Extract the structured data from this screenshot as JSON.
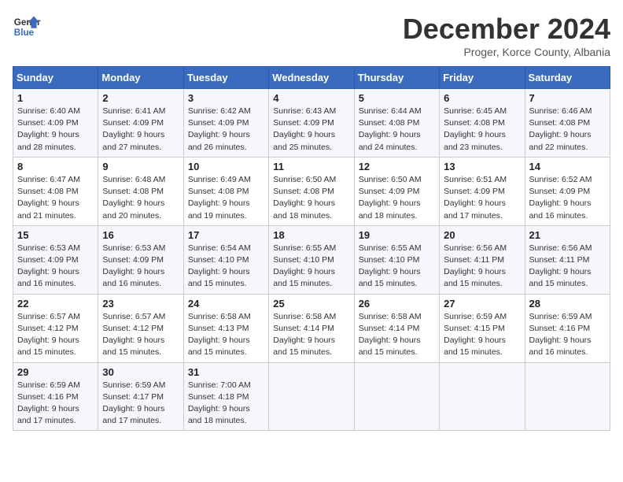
{
  "logo": {
    "line1": "General",
    "line2": "Blue"
  },
  "title": "December 2024",
  "subtitle": "Proger, Korce County, Albania",
  "days_of_week": [
    "Sunday",
    "Monday",
    "Tuesday",
    "Wednesday",
    "Thursday",
    "Friday",
    "Saturday"
  ],
  "weeks": [
    [
      {
        "day": "1",
        "sunrise": "Sunrise: 6:40 AM",
        "sunset": "Sunset: 4:09 PM",
        "daylight": "Daylight: 9 hours and 28 minutes."
      },
      {
        "day": "2",
        "sunrise": "Sunrise: 6:41 AM",
        "sunset": "Sunset: 4:09 PM",
        "daylight": "Daylight: 9 hours and 27 minutes."
      },
      {
        "day": "3",
        "sunrise": "Sunrise: 6:42 AM",
        "sunset": "Sunset: 4:09 PM",
        "daylight": "Daylight: 9 hours and 26 minutes."
      },
      {
        "day": "4",
        "sunrise": "Sunrise: 6:43 AM",
        "sunset": "Sunset: 4:09 PM",
        "daylight": "Daylight: 9 hours and 25 minutes."
      },
      {
        "day": "5",
        "sunrise": "Sunrise: 6:44 AM",
        "sunset": "Sunset: 4:08 PM",
        "daylight": "Daylight: 9 hours and 24 minutes."
      },
      {
        "day": "6",
        "sunrise": "Sunrise: 6:45 AM",
        "sunset": "Sunset: 4:08 PM",
        "daylight": "Daylight: 9 hours and 23 minutes."
      },
      {
        "day": "7",
        "sunrise": "Sunrise: 6:46 AM",
        "sunset": "Sunset: 4:08 PM",
        "daylight": "Daylight: 9 hours and 22 minutes."
      }
    ],
    [
      {
        "day": "8",
        "sunrise": "Sunrise: 6:47 AM",
        "sunset": "Sunset: 4:08 PM",
        "daylight": "Daylight: 9 hours and 21 minutes."
      },
      {
        "day": "9",
        "sunrise": "Sunrise: 6:48 AM",
        "sunset": "Sunset: 4:08 PM",
        "daylight": "Daylight: 9 hours and 20 minutes."
      },
      {
        "day": "10",
        "sunrise": "Sunrise: 6:49 AM",
        "sunset": "Sunset: 4:08 PM",
        "daylight": "Daylight: 9 hours and 19 minutes."
      },
      {
        "day": "11",
        "sunrise": "Sunrise: 6:50 AM",
        "sunset": "Sunset: 4:08 PM",
        "daylight": "Daylight: 9 hours and 18 minutes."
      },
      {
        "day": "12",
        "sunrise": "Sunrise: 6:50 AM",
        "sunset": "Sunset: 4:09 PM",
        "daylight": "Daylight: 9 hours and 18 minutes."
      },
      {
        "day": "13",
        "sunrise": "Sunrise: 6:51 AM",
        "sunset": "Sunset: 4:09 PM",
        "daylight": "Daylight: 9 hours and 17 minutes."
      },
      {
        "day": "14",
        "sunrise": "Sunrise: 6:52 AM",
        "sunset": "Sunset: 4:09 PM",
        "daylight": "Daylight: 9 hours and 16 minutes."
      }
    ],
    [
      {
        "day": "15",
        "sunrise": "Sunrise: 6:53 AM",
        "sunset": "Sunset: 4:09 PM",
        "daylight": "Daylight: 9 hours and 16 minutes."
      },
      {
        "day": "16",
        "sunrise": "Sunrise: 6:53 AM",
        "sunset": "Sunset: 4:09 PM",
        "daylight": "Daylight: 9 hours and 16 minutes."
      },
      {
        "day": "17",
        "sunrise": "Sunrise: 6:54 AM",
        "sunset": "Sunset: 4:10 PM",
        "daylight": "Daylight: 9 hours and 15 minutes."
      },
      {
        "day": "18",
        "sunrise": "Sunrise: 6:55 AM",
        "sunset": "Sunset: 4:10 PM",
        "daylight": "Daylight: 9 hours and 15 minutes."
      },
      {
        "day": "19",
        "sunrise": "Sunrise: 6:55 AM",
        "sunset": "Sunset: 4:10 PM",
        "daylight": "Daylight: 9 hours and 15 minutes."
      },
      {
        "day": "20",
        "sunrise": "Sunrise: 6:56 AM",
        "sunset": "Sunset: 4:11 PM",
        "daylight": "Daylight: 9 hours and 15 minutes."
      },
      {
        "day": "21",
        "sunrise": "Sunrise: 6:56 AM",
        "sunset": "Sunset: 4:11 PM",
        "daylight": "Daylight: 9 hours and 15 minutes."
      }
    ],
    [
      {
        "day": "22",
        "sunrise": "Sunrise: 6:57 AM",
        "sunset": "Sunset: 4:12 PM",
        "daylight": "Daylight: 9 hours and 15 minutes."
      },
      {
        "day": "23",
        "sunrise": "Sunrise: 6:57 AM",
        "sunset": "Sunset: 4:12 PM",
        "daylight": "Daylight: 9 hours and 15 minutes."
      },
      {
        "day": "24",
        "sunrise": "Sunrise: 6:58 AM",
        "sunset": "Sunset: 4:13 PM",
        "daylight": "Daylight: 9 hours and 15 minutes."
      },
      {
        "day": "25",
        "sunrise": "Sunrise: 6:58 AM",
        "sunset": "Sunset: 4:14 PM",
        "daylight": "Daylight: 9 hours and 15 minutes."
      },
      {
        "day": "26",
        "sunrise": "Sunrise: 6:58 AM",
        "sunset": "Sunset: 4:14 PM",
        "daylight": "Daylight: 9 hours and 15 minutes."
      },
      {
        "day": "27",
        "sunrise": "Sunrise: 6:59 AM",
        "sunset": "Sunset: 4:15 PM",
        "daylight": "Daylight: 9 hours and 15 minutes."
      },
      {
        "day": "28",
        "sunrise": "Sunrise: 6:59 AM",
        "sunset": "Sunset: 4:16 PM",
        "daylight": "Daylight: 9 hours and 16 minutes."
      }
    ],
    [
      {
        "day": "29",
        "sunrise": "Sunrise: 6:59 AM",
        "sunset": "Sunset: 4:16 PM",
        "daylight": "Daylight: 9 hours and 17 minutes."
      },
      {
        "day": "30",
        "sunrise": "Sunrise: 6:59 AM",
        "sunset": "Sunset: 4:17 PM",
        "daylight": "Daylight: 9 hours and 17 minutes."
      },
      {
        "day": "31",
        "sunrise": "Sunrise: 7:00 AM",
        "sunset": "Sunset: 4:18 PM",
        "daylight": "Daylight: 9 hours and 18 minutes."
      },
      null,
      null,
      null,
      null
    ]
  ]
}
